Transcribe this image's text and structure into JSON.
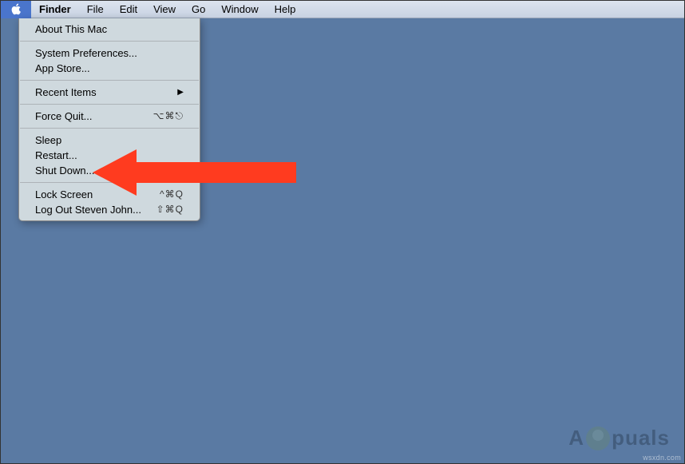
{
  "menubar": {
    "items": [
      {
        "label": "Finder",
        "bold": true
      },
      {
        "label": "File"
      },
      {
        "label": "Edit"
      },
      {
        "label": "View"
      },
      {
        "label": "Go"
      },
      {
        "label": "Window"
      },
      {
        "label": "Help"
      }
    ]
  },
  "appleMenu": {
    "groups": [
      [
        {
          "label": "About This Mac"
        }
      ],
      [
        {
          "label": "System Preferences..."
        },
        {
          "label": "App Store..."
        }
      ],
      [
        {
          "label": "Recent Items",
          "submenu": true
        }
      ],
      [
        {
          "label": "Force Quit...",
          "shortcut": "⌥⌘⎋"
        }
      ],
      [
        {
          "label": "Sleep"
        },
        {
          "label": "Restart..."
        },
        {
          "label": "Shut Down..."
        }
      ],
      [
        {
          "label": "Lock Screen",
          "shortcut": "^⌘Q"
        },
        {
          "label": "Log Out Steven John...",
          "shortcut": "⇧⌘Q"
        }
      ]
    ]
  },
  "annotation": {
    "arrow_color": "#ff3b1f"
  },
  "watermark": {
    "prefix": "A",
    "suffix": "puals"
  },
  "footer": {
    "credit": "wsxdn.com"
  }
}
